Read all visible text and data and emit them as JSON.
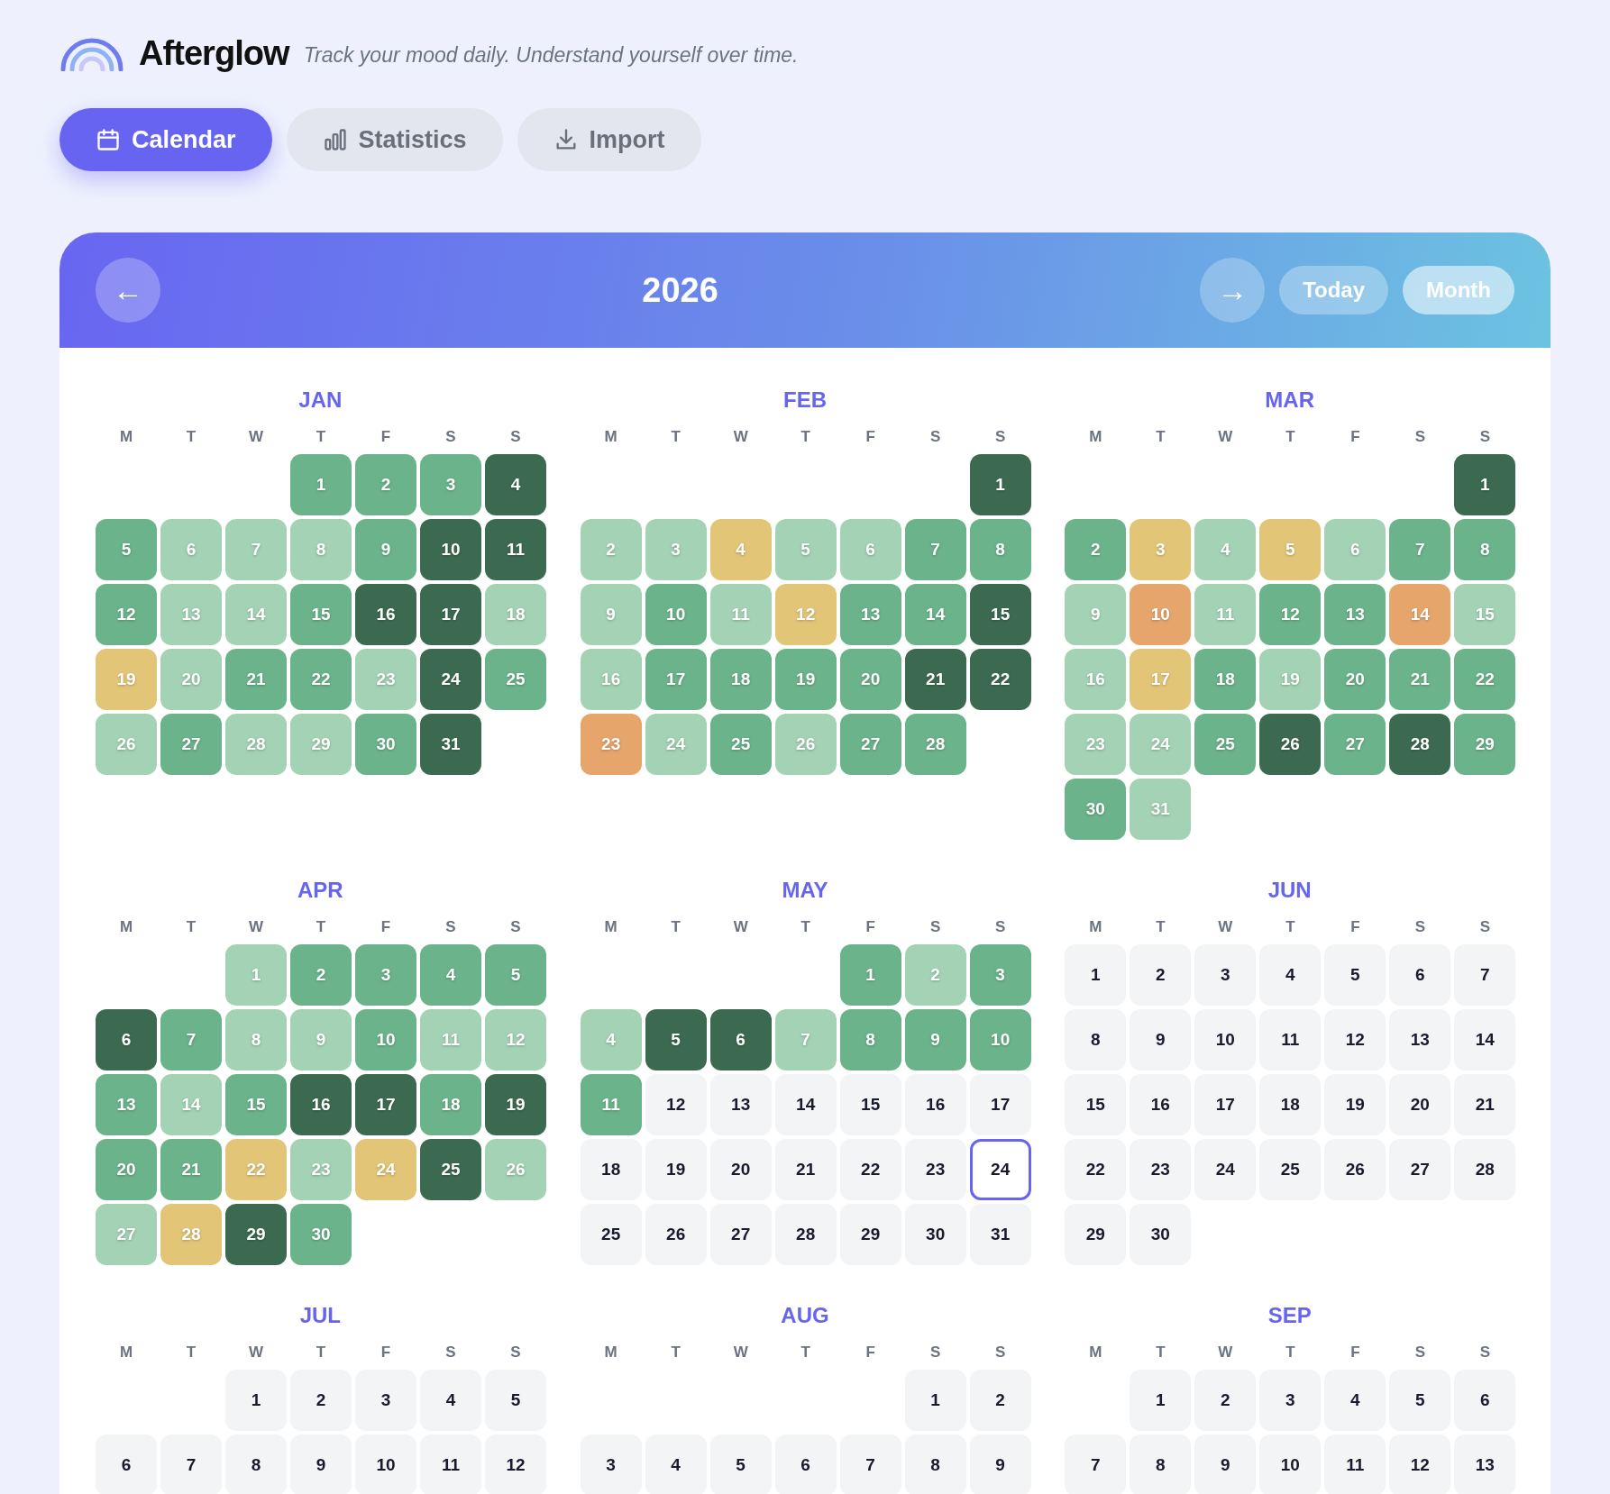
{
  "app": {
    "name": "Afterglow",
    "tagline": "Track your mood daily. Understand yourself over time."
  },
  "tabs": [
    {
      "label": "Calendar",
      "selected": true
    },
    {
      "label": "Statistics",
      "selected": false
    },
    {
      "label": "Import",
      "selected": false
    }
  ],
  "calendar": {
    "prev_button": "←",
    "year": "2026",
    "next_button": "→",
    "today_button": "Today",
    "view_button": "Month",
    "months": [
      {
        "name": "JAN",
        "weekdays": [
          "M",
          "T",
          "W",
          "T",
          "F",
          "S",
          "S"
        ],
        "days": [
          {
            "kind": "blank"
          },
          {
            "kind": "blank"
          },
          {
            "kind": "blank"
          },
          {
            "kind": "day",
            "label": "1",
            "color": "#6bb38b"
          },
          {
            "kind": "day",
            "label": "2",
            "color": "#6bb38b"
          },
          {
            "kind": "day",
            "label": "3",
            "color": "#6bb38b"
          },
          {
            "kind": "day",
            "label": "4",
            "color": "#3c6a50"
          },
          {
            "kind": "day",
            "label": "5",
            "color": "#6bb38b"
          },
          {
            "kind": "day",
            "label": "6",
            "color": "#a3d2b4"
          },
          {
            "kind": "day",
            "label": "7",
            "color": "#a3d2b4"
          },
          {
            "kind": "day",
            "label": "8",
            "color": "#a3d2b4"
          },
          {
            "kind": "day",
            "label": "9",
            "color": "#6bb38b"
          },
          {
            "kind": "day",
            "label": "10",
            "color": "#3c6a50"
          },
          {
            "kind": "day",
            "label": "11",
            "color": "#3c6a50"
          },
          {
            "kind": "day",
            "label": "12",
            "color": "#6bb38b"
          },
          {
            "kind": "day",
            "label": "13",
            "color": "#a3d2b4"
          },
          {
            "kind": "day",
            "label": "14",
            "color": "#a3d2b4"
          },
          {
            "kind": "day",
            "label": "15",
            "color": "#6bb38b"
          },
          {
            "kind": "day",
            "label": "16",
            "color": "#3c6a50"
          },
          {
            "kind": "day",
            "label": "17",
            "color": "#3c6a50"
          },
          {
            "kind": "day",
            "label": "18",
            "color": "#a3d2b4"
          },
          {
            "kind": "day",
            "label": "19",
            "color": "#e2c577"
          },
          {
            "kind": "day",
            "label": "20",
            "color": "#a3d2b4"
          },
          {
            "kind": "day",
            "label": "21",
            "color": "#6bb38b"
          },
          {
            "kind": "day",
            "label": "22",
            "color": "#6bb38b"
          },
          {
            "kind": "day",
            "label": "23",
            "color": "#a3d2b4"
          },
          {
            "kind": "day",
            "label": "24",
            "color": "#3c6a50"
          },
          {
            "kind": "day",
            "label": "25",
            "color": "#6bb38b"
          },
          {
            "kind": "day",
            "label": "26",
            "color": "#a3d2b4"
          },
          {
            "kind": "day",
            "label": "27",
            "color": "#6bb38b"
          },
          {
            "kind": "day",
            "label": "28",
            "color": "#a3d2b4"
          },
          {
            "kind": "day",
            "label": "29",
            "color": "#a3d2b4"
          },
          {
            "kind": "day",
            "label": "30",
            "color": "#6bb38b"
          },
          {
            "kind": "day",
            "label": "31",
            "color": "#3c6a50"
          }
        ]
      },
      {
        "name": "FEB",
        "weekdays": [
          "M",
          "T",
          "W",
          "T",
          "F",
          "S",
          "S"
        ],
        "days": [
          {
            "kind": "blank"
          },
          {
            "kind": "blank"
          },
          {
            "kind": "blank"
          },
          {
            "kind": "blank"
          },
          {
            "kind": "blank"
          },
          {
            "kind": "blank"
          },
          {
            "kind": "day",
            "label": "1",
            "color": "#3c6a50"
          },
          {
            "kind": "day",
            "label": "2",
            "color": "#a3d2b4"
          },
          {
            "kind": "day",
            "label": "3",
            "color": "#a3d2b4"
          },
          {
            "kind": "day",
            "label": "4",
            "color": "#e2c577"
          },
          {
            "kind": "day",
            "label": "5",
            "color": "#a3d2b4"
          },
          {
            "kind": "day",
            "label": "6",
            "color": "#a3d2b4"
          },
          {
            "kind": "day",
            "label": "7",
            "color": "#6bb38b"
          },
          {
            "kind": "day",
            "label": "8",
            "color": "#6bb38b"
          },
          {
            "kind": "day",
            "label": "9",
            "color": "#a3d2b4"
          },
          {
            "kind": "day",
            "label": "10",
            "color": "#6bb38b"
          },
          {
            "kind": "day",
            "label": "11",
            "color": "#a3d2b4"
          },
          {
            "kind": "day",
            "label": "12",
            "color": "#e2c577"
          },
          {
            "kind": "day",
            "label": "13",
            "color": "#6bb38b"
          },
          {
            "kind": "day",
            "label": "14",
            "color": "#6bb38b"
          },
          {
            "kind": "day",
            "label": "15",
            "color": "#3c6a50"
          },
          {
            "kind": "day",
            "label": "16",
            "color": "#a3d2b4"
          },
          {
            "kind": "day",
            "label": "17",
            "color": "#6bb38b"
          },
          {
            "kind": "day",
            "label": "18",
            "color": "#6bb38b"
          },
          {
            "kind": "day",
            "label": "19",
            "color": "#6bb38b"
          },
          {
            "kind": "day",
            "label": "20",
            "color": "#6bb38b"
          },
          {
            "kind": "day",
            "label": "21",
            "color": "#3c6a50"
          },
          {
            "kind": "day",
            "label": "22",
            "color": "#3c6a50"
          },
          {
            "kind": "day",
            "label": "23",
            "color": "#e6a56b"
          },
          {
            "kind": "day",
            "label": "24",
            "color": "#a3d2b4"
          },
          {
            "kind": "day",
            "label": "25",
            "color": "#6bb38b"
          },
          {
            "kind": "day",
            "label": "26",
            "color": "#a3d2b4"
          },
          {
            "kind": "day",
            "label": "27",
            "color": "#6bb38b"
          },
          {
            "kind": "day",
            "label": "28",
            "color": "#6bb38b"
          }
        ]
      },
      {
        "name": "MAR",
        "weekdays": [
          "M",
          "T",
          "W",
          "T",
          "F",
          "S",
          "S"
        ],
        "days": [
          {
            "kind": "blank"
          },
          {
            "kind": "blank"
          },
          {
            "kind": "blank"
          },
          {
            "kind": "blank"
          },
          {
            "kind": "blank"
          },
          {
            "kind": "blank"
          },
          {
            "kind": "day",
            "label": "1",
            "color": "#3c6a50"
          },
          {
            "kind": "day",
            "label": "2",
            "color": "#6bb38b"
          },
          {
            "kind": "day",
            "label": "3",
            "color": "#e2c577"
          },
          {
            "kind": "day",
            "label": "4",
            "color": "#a3d2b4"
          },
          {
            "kind": "day",
            "label": "5",
            "color": "#e2c577"
          },
          {
            "kind": "day",
            "label": "6",
            "color": "#a3d2b4"
          },
          {
            "kind": "day",
            "label": "7",
            "color": "#6bb38b"
          },
          {
            "kind": "day",
            "label": "8",
            "color": "#6bb38b"
          },
          {
            "kind": "day",
            "label": "9",
            "color": "#a3d2b4"
          },
          {
            "kind": "day",
            "label": "10",
            "color": "#e6a56b"
          },
          {
            "kind": "day",
            "label": "11",
            "color": "#a3d2b4"
          },
          {
            "kind": "day",
            "label": "12",
            "color": "#6bb38b"
          },
          {
            "kind": "day",
            "label": "13",
            "color": "#6bb38b"
          },
          {
            "kind": "day",
            "label": "14",
            "color": "#e6a56b"
          },
          {
            "kind": "day",
            "label": "15",
            "color": "#a3d2b4"
          },
          {
            "kind": "day",
            "label": "16",
            "color": "#a3d2b4"
          },
          {
            "kind": "day",
            "label": "17",
            "color": "#e2c577"
          },
          {
            "kind": "day",
            "label": "18",
            "color": "#6bb38b"
          },
          {
            "kind": "day",
            "label": "19",
            "color": "#a3d2b4"
          },
          {
            "kind": "day",
            "label": "20",
            "color": "#6bb38b"
          },
          {
            "kind": "day",
            "label": "21",
            "color": "#6bb38b"
          },
          {
            "kind": "day",
            "label": "22",
            "color": "#6bb38b"
          },
          {
            "kind": "day",
            "label": "23",
            "color": "#a3d2b4"
          },
          {
            "kind": "day",
            "label": "24",
            "color": "#a3d2b4"
          },
          {
            "kind": "day",
            "label": "25",
            "color": "#6bb38b"
          },
          {
            "kind": "day",
            "label": "26",
            "color": "#3c6a50"
          },
          {
            "kind": "day",
            "label": "27",
            "color": "#6bb38b"
          },
          {
            "kind": "day",
            "label": "28",
            "color": "#3c6a50"
          },
          {
            "kind": "day",
            "label": "29",
            "color": "#6bb38b"
          },
          {
            "kind": "day",
            "label": "30",
            "color": "#6bb38b"
          },
          {
            "kind": "day",
            "label": "31",
            "color": "#a3d2b4"
          }
        ]
      },
      {
        "name": "APR",
        "weekdays": [
          "M",
          "T",
          "W",
          "T",
          "F",
          "S",
          "S"
        ],
        "days": [
          {
            "kind": "blank"
          },
          {
            "kind": "blank"
          },
          {
            "kind": "day",
            "label": "1",
            "color": "#a3d2b4"
          },
          {
            "kind": "day",
            "label": "2",
            "color": "#6bb38b"
          },
          {
            "kind": "day",
            "label": "3",
            "color": "#6bb38b"
          },
          {
            "kind": "day",
            "label": "4",
            "color": "#6bb38b"
          },
          {
            "kind": "day",
            "label": "5",
            "color": "#6bb38b"
          },
          {
            "kind": "day",
            "label": "6",
            "color": "#3c6a50"
          },
          {
            "kind": "day",
            "label": "7",
            "color": "#6bb38b"
          },
          {
            "kind": "day",
            "label": "8",
            "color": "#a3d2b4"
          },
          {
            "kind": "day",
            "label": "9",
            "color": "#a3d2b4"
          },
          {
            "kind": "day",
            "label": "10",
            "color": "#6bb38b"
          },
          {
            "kind": "day",
            "label": "11",
            "color": "#a3d2b4"
          },
          {
            "kind": "day",
            "label": "12",
            "color": "#a3d2b4"
          },
          {
            "kind": "day",
            "label": "13",
            "color": "#6bb38b"
          },
          {
            "kind": "day",
            "label": "14",
            "color": "#a3d2b4"
          },
          {
            "kind": "day",
            "label": "15",
            "color": "#6bb38b"
          },
          {
            "kind": "day",
            "label": "16",
            "color": "#3c6a50"
          },
          {
            "kind": "day",
            "label": "17",
            "color": "#3c6a50"
          },
          {
            "kind": "day",
            "label": "18",
            "color": "#6bb38b"
          },
          {
            "kind": "day",
            "label": "19",
            "color": "#3c6a50"
          },
          {
            "kind": "day",
            "label": "20",
            "color": "#6bb38b"
          },
          {
            "kind": "day",
            "label": "21",
            "color": "#6bb38b"
          },
          {
            "kind": "day",
            "label": "22",
            "color": "#e2c577"
          },
          {
            "kind": "day",
            "label": "23",
            "color": "#a3d2b4"
          },
          {
            "kind": "day",
            "label": "24",
            "color": "#e2c577"
          },
          {
            "kind": "day",
            "label": "25",
            "color": "#3c6a50"
          },
          {
            "kind": "day",
            "label": "26",
            "color": "#a3d2b4"
          },
          {
            "kind": "day",
            "label": "27",
            "color": "#a3d2b4"
          },
          {
            "kind": "day",
            "label": "28",
            "color": "#e2c577"
          },
          {
            "kind": "day",
            "label": "29",
            "color": "#3c6a50"
          },
          {
            "kind": "day",
            "label": "30",
            "color": "#6bb38b"
          }
        ]
      },
      {
        "name": "MAY",
        "weekdays": [
          "M",
          "T",
          "W",
          "T",
          "F",
          "S",
          "S"
        ],
        "days": [
          {
            "kind": "blank"
          },
          {
            "kind": "blank"
          },
          {
            "kind": "blank"
          },
          {
            "kind": "blank"
          },
          {
            "kind": "day",
            "label": "1",
            "color": "#6bb38b"
          },
          {
            "kind": "day",
            "label": "2",
            "color": "#a3d2b4"
          },
          {
            "kind": "day",
            "label": "3",
            "color": "#6bb38b"
          },
          {
            "kind": "day",
            "label": "4",
            "color": "#a3d2b4"
          },
          {
            "kind": "day",
            "label": "5",
            "color": "#3c6a50"
          },
          {
            "kind": "day",
            "label": "6",
            "color": "#3c6a50"
          },
          {
            "kind": "day",
            "label": "7",
            "color": "#a3d2b4"
          },
          {
            "kind": "day",
            "label": "8",
            "color": "#6bb38b"
          },
          {
            "kind": "day",
            "label": "9",
            "color": "#6bb38b"
          },
          {
            "kind": "day",
            "label": "10",
            "color": "#6bb38b"
          },
          {
            "kind": "day",
            "label": "11",
            "color": "#6bb38b"
          },
          {
            "kind": "day",
            "label": "12"
          },
          {
            "kind": "day",
            "label": "13"
          },
          {
            "kind": "day",
            "label": "14"
          },
          {
            "kind": "day",
            "label": "15"
          },
          {
            "kind": "day",
            "label": "16"
          },
          {
            "kind": "day",
            "label": "17"
          },
          {
            "kind": "day",
            "label": "18"
          },
          {
            "kind": "day",
            "label": "19"
          },
          {
            "kind": "day",
            "label": "20"
          },
          {
            "kind": "day",
            "label": "21"
          },
          {
            "kind": "day",
            "label": "22"
          },
          {
            "kind": "day",
            "label": "23"
          },
          {
            "kind": "today",
            "label": "24"
          },
          {
            "kind": "day",
            "label": "25"
          },
          {
            "kind": "day",
            "label": "26"
          },
          {
            "kind": "day",
            "label": "27"
          },
          {
            "kind": "day",
            "label": "28"
          },
          {
            "kind": "day",
            "label": "29"
          },
          {
            "kind": "day",
            "label": "30"
          },
          {
            "kind": "day",
            "label": "31"
          }
        ]
      },
      {
        "name": "JUN",
        "weekdays": [
          "M",
          "T",
          "W",
          "T",
          "F",
          "S",
          "S"
        ],
        "days": [
          {
            "kind": "day",
            "label": "1"
          },
          {
            "kind": "day",
            "label": "2"
          },
          {
            "kind": "day",
            "label": "3"
          },
          {
            "kind": "day",
            "label": "4"
          },
          {
            "kind": "day",
            "label": "5"
          },
          {
            "kind": "day",
            "label": "6"
          },
          {
            "kind": "day",
            "label": "7"
          },
          {
            "kind": "day",
            "label": "8"
          },
          {
            "kind": "day",
            "label": "9"
          },
          {
            "kind": "day",
            "label": "10"
          },
          {
            "kind": "day",
            "label": "11"
          },
          {
            "kind": "day",
            "label": "12"
          },
          {
            "kind": "day",
            "label": "13"
          },
          {
            "kind": "day",
            "label": "14"
          },
          {
            "kind": "day",
            "label": "15"
          },
          {
            "kind": "day",
            "label": "16"
          },
          {
            "kind": "day",
            "label": "17"
          },
          {
            "kind": "day",
            "label": "18"
          },
          {
            "kind": "day",
            "label": "19"
          },
          {
            "kind": "day",
            "label": "20"
          },
          {
            "kind": "day",
            "label": "21"
          },
          {
            "kind": "day",
            "label": "22"
          },
          {
            "kind": "day",
            "label": "23"
          },
          {
            "kind": "day",
            "label": "24"
          },
          {
            "kind": "day",
            "label": "25"
          },
          {
            "kind": "day",
            "label": "26"
          },
          {
            "kind": "day",
            "label": "27"
          },
          {
            "kind": "day",
            "label": "28"
          },
          {
            "kind": "day",
            "label": "29"
          },
          {
            "kind": "day",
            "label": "30"
          }
        ]
      },
      {
        "name": "JUL",
        "weekdays": [
          "M",
          "T",
          "W",
          "T",
          "F",
          "S",
          "S"
        ],
        "days": [
          {
            "kind": "blank"
          },
          {
            "kind": "blank"
          },
          {
            "kind": "day",
            "label": "1"
          },
          {
            "kind": "day",
            "label": "2"
          },
          {
            "kind": "day",
            "label": "3"
          },
          {
            "kind": "day",
            "label": "4"
          },
          {
            "kind": "day",
            "label": "5"
          },
          {
            "kind": "day",
            "label": "6"
          },
          {
            "kind": "day",
            "label": "7"
          },
          {
            "kind": "day",
            "label": "8"
          },
          {
            "kind": "day",
            "label": "9"
          },
          {
            "kind": "day",
            "label": "10"
          },
          {
            "kind": "day",
            "label": "11"
          },
          {
            "kind": "day",
            "label": "12"
          }
        ]
      },
      {
        "name": "AUG",
        "weekdays": [
          "M",
          "T",
          "W",
          "T",
          "F",
          "S",
          "S"
        ],
        "days": [
          {
            "kind": "blank"
          },
          {
            "kind": "blank"
          },
          {
            "kind": "blank"
          },
          {
            "kind": "blank"
          },
          {
            "kind": "blank"
          },
          {
            "kind": "day",
            "label": "1"
          },
          {
            "kind": "day",
            "label": "2"
          },
          {
            "kind": "day",
            "label": "3"
          },
          {
            "kind": "day",
            "label": "4"
          },
          {
            "kind": "day",
            "label": "5"
          },
          {
            "kind": "day",
            "label": "6"
          },
          {
            "kind": "day",
            "label": "7"
          },
          {
            "kind": "day",
            "label": "8"
          },
          {
            "kind": "day",
            "label": "9"
          }
        ]
      },
      {
        "name": "SEP",
        "weekdays": [
          "M",
          "T",
          "W",
          "T",
          "F",
          "S",
          "S"
        ],
        "days": [
          {
            "kind": "blank"
          },
          {
            "kind": "day",
            "label": "1"
          },
          {
            "kind": "day",
            "label": "2"
          },
          {
            "kind": "day",
            "label": "3"
          },
          {
            "kind": "day",
            "label": "4"
          },
          {
            "kind": "day",
            "label": "5"
          },
          {
            "kind": "day",
            "label": "6"
          },
          {
            "kind": "day",
            "label": "7"
          },
          {
            "kind": "day",
            "label": "8"
          },
          {
            "kind": "day",
            "label": "9"
          },
          {
            "kind": "day",
            "label": "10"
          },
          {
            "kind": "day",
            "label": "11"
          },
          {
            "kind": "day",
            "label": "12"
          },
          {
            "kind": "day",
            "label": "13"
          }
        ]
      }
    ]
  }
}
